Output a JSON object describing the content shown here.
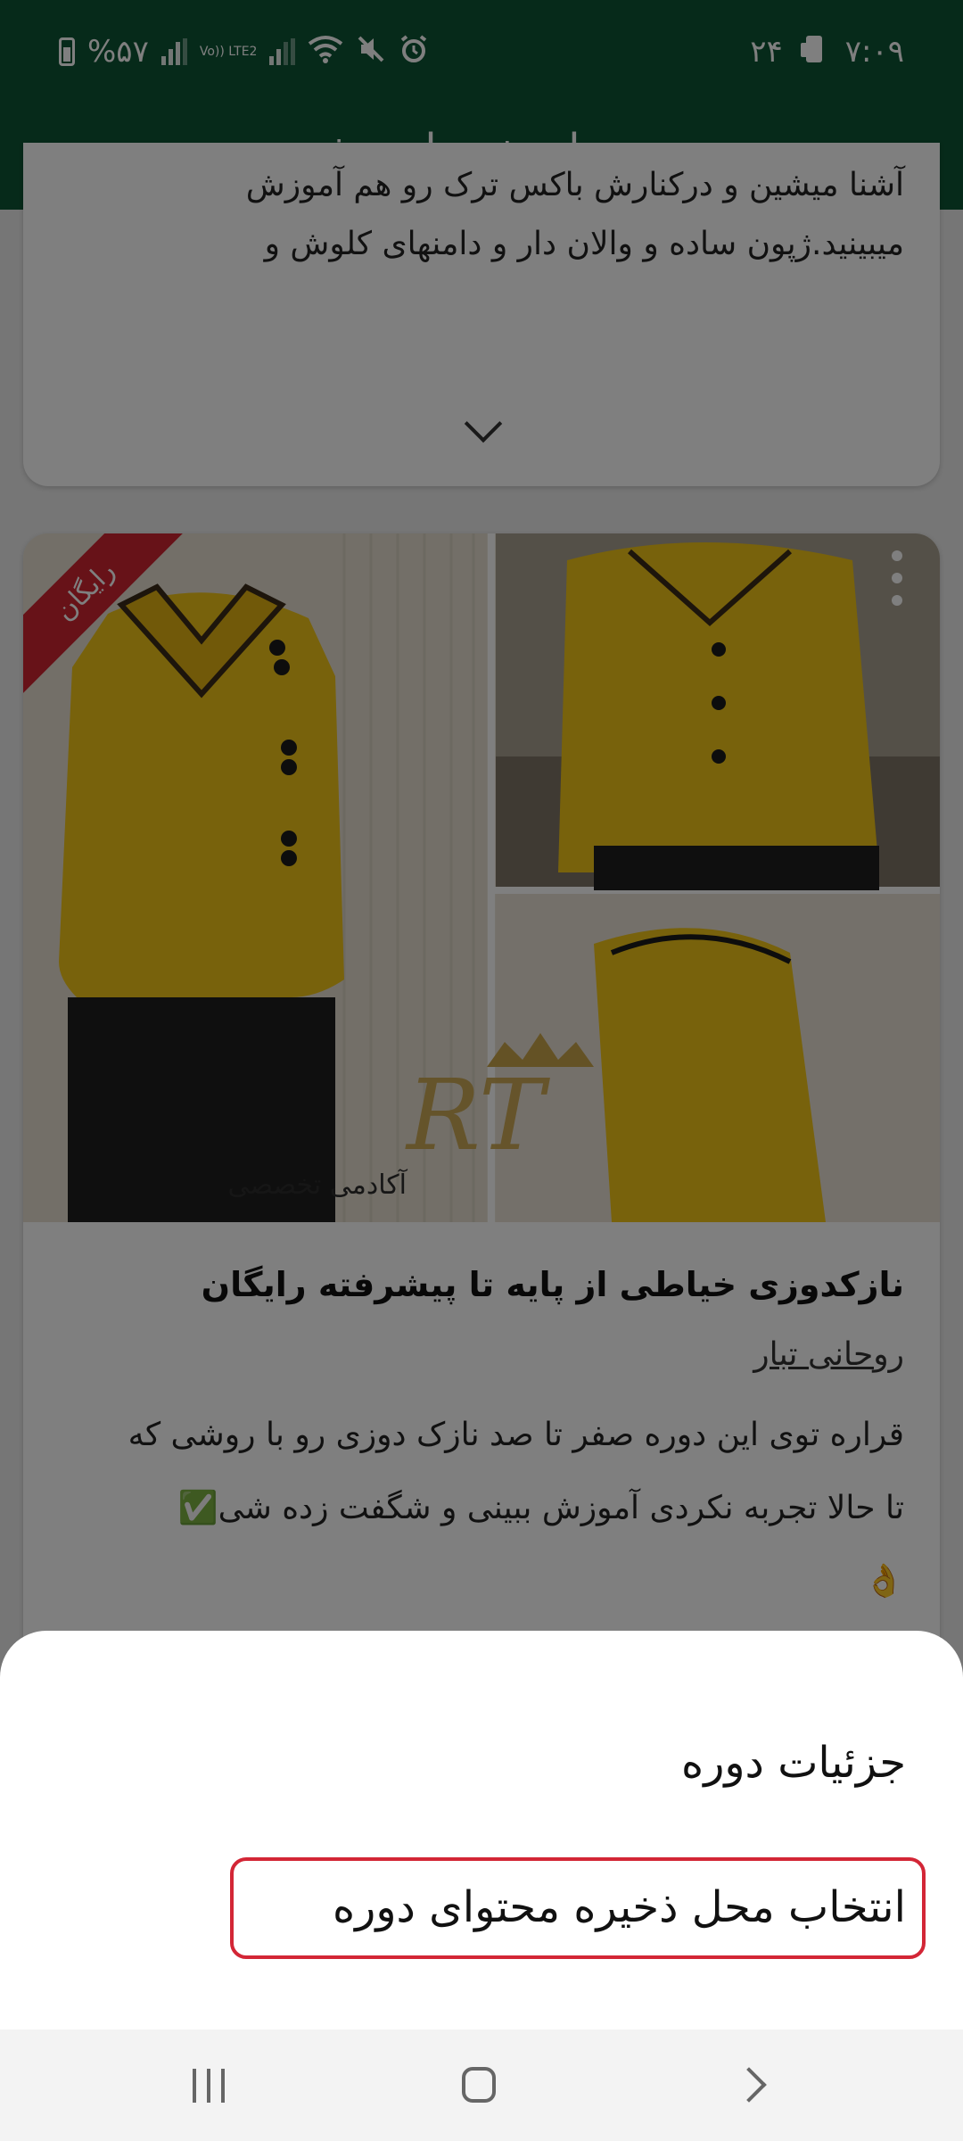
{
  "status_bar": {
    "battery_percent": "%۵۷",
    "network_label": "Vo)) LTE2",
    "date": "۲۴",
    "time": "۷:۰۹",
    "icons": [
      "battery-icon",
      "signal-icon",
      "volte-icon",
      "signal-icon-2",
      "wifi-icon",
      "mute-icon",
      "alarm-icon",
      "device-icon"
    ]
  },
  "app_bar": {
    "title": "دوره‌های خریداری شده"
  },
  "feed": {
    "card1": {
      "line1": "آشنا میشین و درکنارش باکس ترک رو هم آموزش",
      "line2": "میبینید.ژپون  ساده و والان دار و دامنهای کلوش و"
    },
    "card2": {
      "badge": "رایگان",
      "image_watermark": "RT",
      "image_watermark_sub": "آکادمی تخصصی",
      "title": "نازکدوزی  خیاطی از پایه تا پیشرفته رایگان",
      "author": "روحانی تبار",
      "desc_line1": "قراره توی این دوره صفر تا صد نازک دوزی رو با روشی که",
      "desc_line2": "تا حالا تجربه نکردی آموزش ببینی و شگفت زده شی✅",
      "desc_line3": "👌"
    }
  },
  "bottom_sheet": {
    "items": [
      {
        "label": "جزئیات دوره"
      },
      {
        "label": "انتخاب محل ذخیره محتوای دوره"
      }
    ],
    "highlight_color": "#d32636"
  },
  "colors": {
    "primary": "#0d5434",
    "badge": "#cf2431"
  }
}
